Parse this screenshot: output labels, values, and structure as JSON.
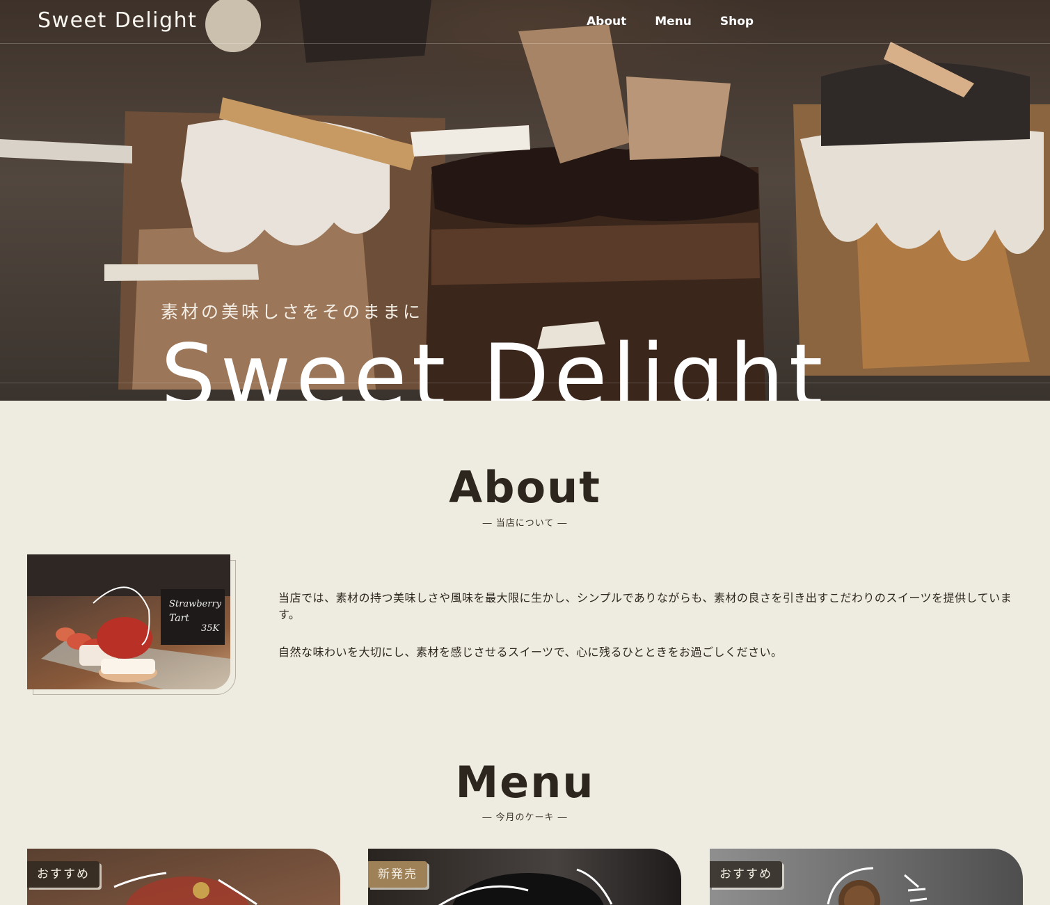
{
  "header": {
    "logo": "Sweet Delight",
    "nav": [
      "About",
      "Menu",
      "Shop"
    ]
  },
  "hero": {
    "tagline": "素材の美味しさをそのままに",
    "title": "Sweet Delight"
  },
  "about": {
    "title": "About",
    "subtitle": "― 当店について ―",
    "image_label": "Strawberry Tart 35K",
    "paragraphs": [
      "当店では、素材の持つ美味しさや風味を最大限に生かし、シンプルでありながらも、素材の良さを引き出すこだわりのスイーツを提供しています。",
      "自然な味わいを大切にし、素材を感じさせるスイーツで、心に残るひとときをお過ごしください。"
    ]
  },
  "menu": {
    "title": "Menu",
    "subtitle": "― 今月のケーキ ―",
    "cards": [
      {
        "badge": "おすすめ"
      },
      {
        "badge": "新発売"
      },
      {
        "badge": "おすすめ"
      }
    ]
  },
  "colors": {
    "background": "#eeebe1",
    "text": "#2e2820",
    "badge_dark": "#2e2820",
    "badge_new": "#9e8157"
  }
}
